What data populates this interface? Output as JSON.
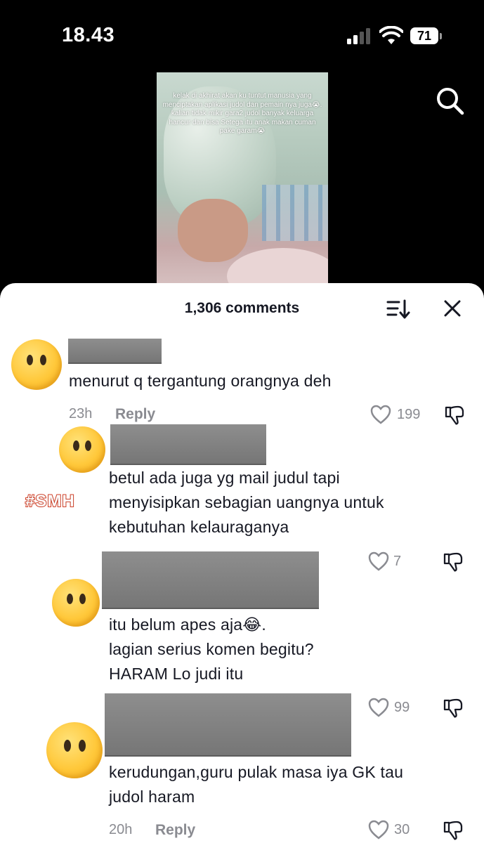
{
  "status_bar": {
    "time": "18.43",
    "battery": "71"
  },
  "video": {
    "caption": "kelak di akhirat akan ku tuntut manusia yang menciptakan aplikasi judol dan pemain nya juga😭. kalian tidak mikir gara2 judol banyak keluarga hancur dan bisa Setega itu anak makan cuman pake garam😭"
  },
  "comments_header": {
    "title": "1,306 comments"
  },
  "sticker": "#SMH",
  "comments": [
    {
      "text": "menurut q tergantung orangnya deh",
      "time": "23h",
      "reply": "Reply",
      "likes": "199"
    },
    {
      "text": "betul ada juga yg mail judul tapi\nmenyisipkan sebagian uangnya untuk\nkebutuhan kelauraganya",
      "likes": "7"
    },
    {
      "text": "itu belum apes aja😂.\nlagian serius komen begitu?\nHARAM Lo judi itu",
      "likes": "99"
    },
    {
      "text": "kerudungan,guru pulak masa iya GK tau\njudol haram",
      "time": "20h",
      "reply": "Reply",
      "likes": "30"
    }
  ],
  "colors": {
    "sheet": "#ffffff",
    "text": "#161823",
    "muted": "#8a8b91",
    "redaction": "#7d7d7d"
  }
}
